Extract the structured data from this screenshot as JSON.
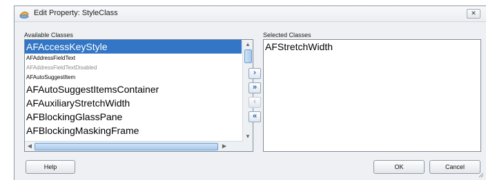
{
  "window": {
    "title": "Edit Property: StyleClass",
    "close_glyph": "✕"
  },
  "available": {
    "label": "Available Classes",
    "items": [
      {
        "text": "AFAccessKeyStyle",
        "size": "big",
        "selected": true,
        "disabled": false
      },
      {
        "text": "AFAddressFieldText",
        "size": "small",
        "selected": false,
        "disabled": false
      },
      {
        "text": "AFAddressFieldTextDisabled",
        "size": "small",
        "selected": false,
        "disabled": true
      },
      {
        "text": "AFAutoSuggestItem",
        "size": "small",
        "selected": false,
        "disabled": false
      },
      {
        "text": "AFAutoSuggestItemsContainer",
        "size": "big",
        "selected": false,
        "disabled": false
      },
      {
        "text": "AFAuxiliaryStretchWidth",
        "size": "big",
        "selected": false,
        "disabled": false
      },
      {
        "text": "AFBlockingGlassPane",
        "size": "big",
        "selected": false,
        "disabled": false
      },
      {
        "text": "AFBlockingMaskingFrame",
        "size": "big",
        "selected": false,
        "disabled": false
      }
    ]
  },
  "move_buttons": [
    {
      "name": "move-right-button",
      "glyph": "›",
      "enabled": true
    },
    {
      "name": "move-all-right-button",
      "glyph": "»",
      "enabled": true
    },
    {
      "name": "move-left-button",
      "glyph": "‹",
      "enabled": false
    },
    {
      "name": "move-all-left-button",
      "glyph": "«",
      "enabled": true
    }
  ],
  "selected": {
    "label": "Selected Classes",
    "items": [
      "AFStretchWidth"
    ]
  },
  "footer": {
    "help": "Help",
    "ok": "OK",
    "cancel": "Cancel"
  },
  "colors": {
    "selection": "#3276c5",
    "dialog_bg": "#eef0f3",
    "button_glyph": "#1e5fb0"
  }
}
